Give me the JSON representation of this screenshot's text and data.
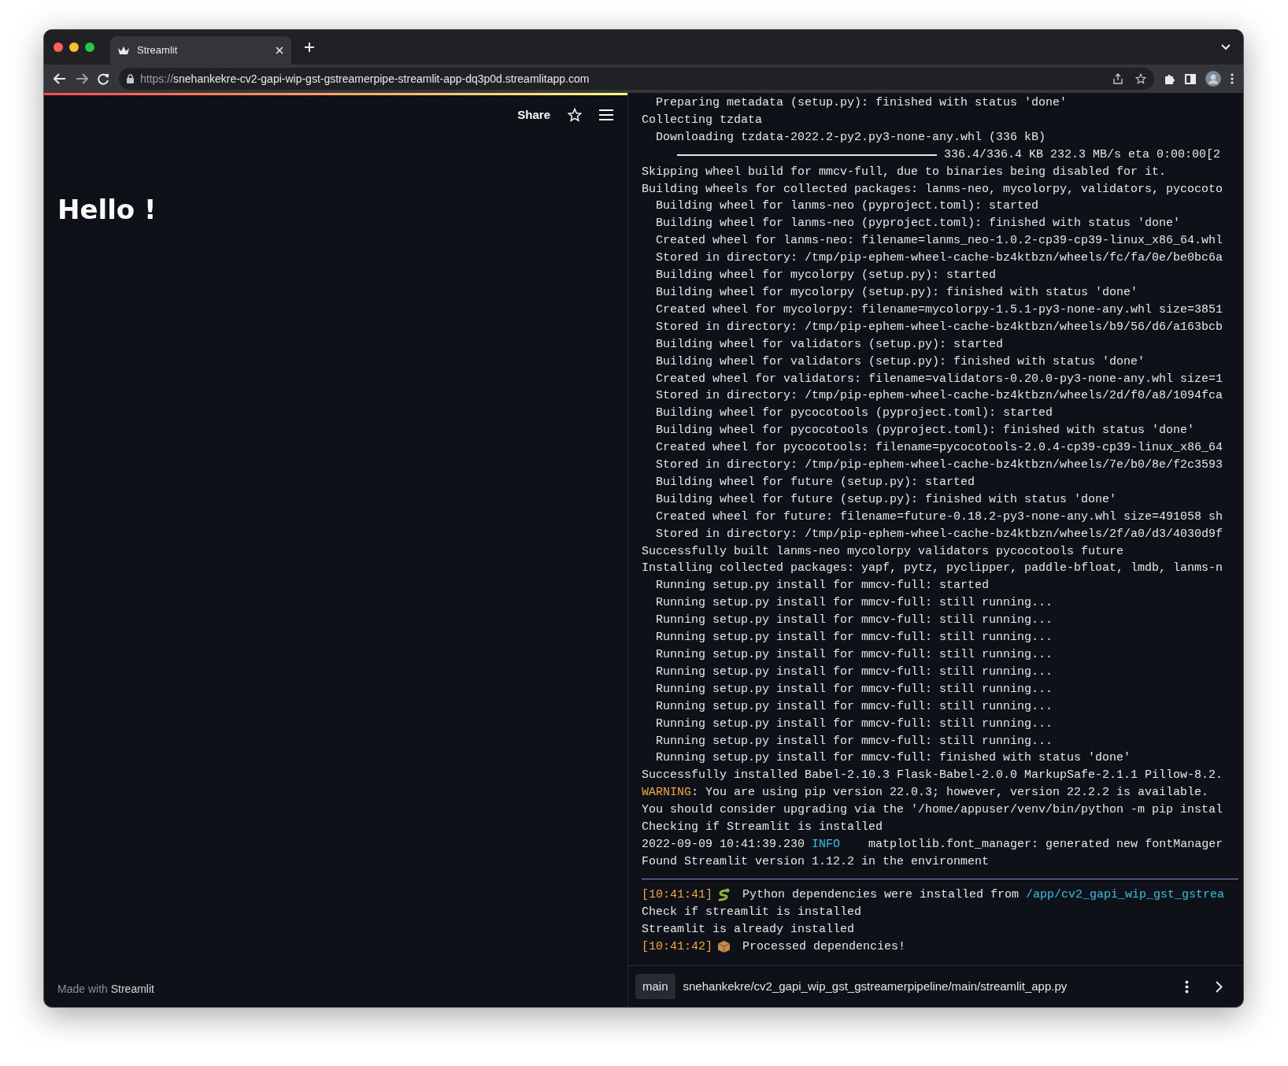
{
  "browser": {
    "tab": {
      "title": "Streamlit",
      "selected": true
    },
    "url": {
      "scheme": "https://",
      "host": "snehankekre-cv2-gapi-wip-gst-gstreamerpipe-streamlit-app-dq3p0d.streamlitapp.com"
    }
  },
  "app": {
    "toolbar": {
      "share": "Share"
    },
    "heading": "Hello !",
    "footer": {
      "prefix": "Made with",
      "brand": "Streamlit"
    }
  },
  "log": {
    "lines": [
      {
        "kind": "text",
        "segments": [
          {
            "text": "  Preparing metadata (setup.py): finished with status 'done'"
          }
        ]
      },
      {
        "kind": "text",
        "segments": [
          {
            "text": "Collecting tzdata"
          }
        ]
      },
      {
        "kind": "text",
        "segments": [
          {
            "text": "  Downloading tzdata-2022.2-py2.py3-none-any.whl (336 kB)"
          }
        ]
      },
      {
        "kind": "progress",
        "level": 1,
        "reading": "336.4/336.4 KB 232.3 MB/s eta 0:00:00[2"
      },
      {
        "kind": "text",
        "segments": [
          {
            "text": "Skipping wheel build for mmcv-full, due to binaries being disabled for it."
          }
        ]
      },
      {
        "kind": "text",
        "segments": [
          {
            "text": "Building wheels for collected packages: lanms-neo, mycolorpy, validators, pycocoto"
          }
        ]
      },
      {
        "kind": "text",
        "segments": [
          {
            "text": "  Building wheel for lanms-neo (pyproject.toml): started"
          }
        ]
      },
      {
        "kind": "text",
        "segments": [
          {
            "text": "  Building wheel for lanms-neo (pyproject.toml): finished with status 'done'"
          }
        ]
      },
      {
        "kind": "text",
        "segments": [
          {
            "text": "  Created wheel for lanms-neo: filename=lanms_neo-1.0.2-cp39-cp39-linux_x86_64.whl"
          }
        ]
      },
      {
        "kind": "text",
        "segments": [
          {
            "text": "  Stored in directory: /tmp/pip-ephem-wheel-cache-bz4ktbzn/wheels/fc/fa/0e/be0bc6a"
          }
        ]
      },
      {
        "kind": "text",
        "segments": [
          {
            "text": "  Building wheel for mycolorpy (setup.py): started"
          }
        ]
      },
      {
        "kind": "text",
        "segments": [
          {
            "text": "  Building wheel for mycolorpy (setup.py): finished with status 'done'"
          }
        ]
      },
      {
        "kind": "text",
        "segments": [
          {
            "text": "  Created wheel for mycolorpy: filename=mycolorpy-1.5.1-py3-none-any.whl size=3851"
          }
        ]
      },
      {
        "kind": "text",
        "segments": [
          {
            "text": "  Stored in directory: /tmp/pip-ephem-wheel-cache-bz4ktbzn/wheels/b9/56/d6/a163bcb"
          }
        ]
      },
      {
        "kind": "text",
        "segments": [
          {
            "text": "  Building wheel for validators (setup.py): started"
          }
        ]
      },
      {
        "kind": "text",
        "segments": [
          {
            "text": "  Building wheel for validators (setup.py): finished with status 'done'"
          }
        ]
      },
      {
        "kind": "text",
        "segments": [
          {
            "text": "  Created wheel for validators: filename=validators-0.20.0-py3-none-any.whl size=1"
          }
        ]
      },
      {
        "kind": "text",
        "segments": [
          {
            "text": "  Stored in directory: /tmp/pip-ephem-wheel-cache-bz4ktbzn/wheels/2d/f0/a8/1094fca"
          }
        ]
      },
      {
        "kind": "text",
        "segments": [
          {
            "text": "  Building wheel for pycocotools (pyproject.toml): started"
          }
        ]
      },
      {
        "kind": "text",
        "segments": [
          {
            "text": "  Building wheel for pycocotools (pyproject.toml): finished with status 'done'"
          }
        ]
      },
      {
        "kind": "text",
        "segments": [
          {
            "text": "  Created wheel for pycocotools: filename=pycocotools-2.0.4-cp39-cp39-linux_x86_64"
          }
        ]
      },
      {
        "kind": "text",
        "segments": [
          {
            "text": "  Stored in directory: /tmp/pip-ephem-wheel-cache-bz4ktbzn/wheels/7e/b0/8e/f2c3593"
          }
        ]
      },
      {
        "kind": "text",
        "segments": [
          {
            "text": "  Building wheel for future (setup.py): started"
          }
        ]
      },
      {
        "kind": "text",
        "segments": [
          {
            "text": "  Building wheel for future (setup.py): finished with status 'done'"
          }
        ]
      },
      {
        "kind": "text",
        "segments": [
          {
            "text": "  Created wheel for future: filename=future-0.18.2-py3-none-any.whl size=491058 sh"
          }
        ]
      },
      {
        "kind": "text",
        "segments": [
          {
            "text": "  Stored in directory: /tmp/pip-ephem-wheel-cache-bz4ktbzn/wheels/2f/a0/d3/4030d9f"
          }
        ]
      },
      {
        "kind": "text",
        "segments": [
          {
            "text": "Successfully built lanms-neo mycolorpy validators pycocotools future"
          }
        ]
      },
      {
        "kind": "text",
        "segments": [
          {
            "text": "Installing collected packages: yapf, pytz, pyclipper, paddle-bfloat, lmdb, lanms-n"
          }
        ]
      },
      {
        "kind": "text",
        "segments": [
          {
            "text": "  Running setup.py install for mmcv-full: started"
          }
        ]
      },
      {
        "kind": "text",
        "segments": [
          {
            "text": "  Running setup.py install for mmcv-full: still running..."
          }
        ]
      },
      {
        "kind": "text",
        "segments": [
          {
            "text": "  Running setup.py install for mmcv-full: still running..."
          }
        ]
      },
      {
        "kind": "text",
        "segments": [
          {
            "text": "  Running setup.py install for mmcv-full: still running..."
          }
        ]
      },
      {
        "kind": "text",
        "segments": [
          {
            "text": "  Running setup.py install for mmcv-full: still running..."
          }
        ]
      },
      {
        "kind": "text",
        "segments": [
          {
            "text": "  Running setup.py install for mmcv-full: still running..."
          }
        ]
      },
      {
        "kind": "text",
        "segments": [
          {
            "text": "  Running setup.py install for mmcv-full: still running..."
          }
        ]
      },
      {
        "kind": "text",
        "segments": [
          {
            "text": "  Running setup.py install for mmcv-full: still running..."
          }
        ]
      },
      {
        "kind": "text",
        "segments": [
          {
            "text": "  Running setup.py install for mmcv-full: still running..."
          }
        ]
      },
      {
        "kind": "text",
        "segments": [
          {
            "text": "  Running setup.py install for mmcv-full: still running..."
          }
        ]
      },
      {
        "kind": "text",
        "segments": [
          {
            "text": "  Running setup.py install for mmcv-full: finished with status 'done'"
          }
        ]
      },
      {
        "kind": "text",
        "segments": [
          {
            "text": "Successfully installed Babel-2.10.3 Flask-Babel-2.0.0 MarkupSafe-2.1.1 Pillow-8.2."
          }
        ]
      },
      {
        "kind": "text",
        "segments": [
          {
            "text": "WARNING",
            "color": "#f0a73a"
          },
          {
            "text": ": You are using pip version 22.0.3; however, version 22.2.2 is available."
          }
        ]
      },
      {
        "kind": "text",
        "segments": [
          {
            "text": "You should consider upgrading via the '/home/appuser/venv/bin/python -m pip instal"
          }
        ]
      },
      {
        "kind": "text",
        "segments": [
          {
            "text": "Checking if Streamlit is installed"
          }
        ]
      },
      {
        "kind": "text",
        "segments": [
          {
            "text": "2022-09-09 10:41:39.230 "
          },
          {
            "text": "INFO",
            "color": "#2ec4e6"
          },
          {
            "text": "    matplotlib.font_manager: generated new fontManager"
          }
        ]
      },
      {
        "kind": "text",
        "segments": [
          {
            "text": "Found Streamlit version 1.12.2 in the environment"
          }
        ]
      }
    ],
    "deploy_lines": [
      {
        "kind": "step",
        "segments": [
          {
            "text": "[10:41:41]",
            "color": "#f0a73a"
          },
          {
            "text": " Python dependencies were installed from "
          },
          {
            "text": "/app/cv2_gapi_wip_gst_gstrea",
            "color": "#2ec4e6"
          }
        ]
      },
      {
        "kind": "text",
        "segments": [
          {
            "text": "Check if streamlit is installed"
          }
        ]
      },
      {
        "kind": "text",
        "segments": [
          {
            "text": "Streamlit is already installed"
          }
        ]
      },
      {
        "kind": "step",
        "segments": [
          {
            "text": "[10:41:42]",
            "color": "#f0a73a"
          },
          {
            "text": " Processed dependencies!"
          }
        ]
      }
    ]
  },
  "status_bar": {
    "branch": "main",
    "path": "snehankekre/cv2_gapi_wip_gst_gstreamerpipeline/main/streamlit_app.py"
  }
}
